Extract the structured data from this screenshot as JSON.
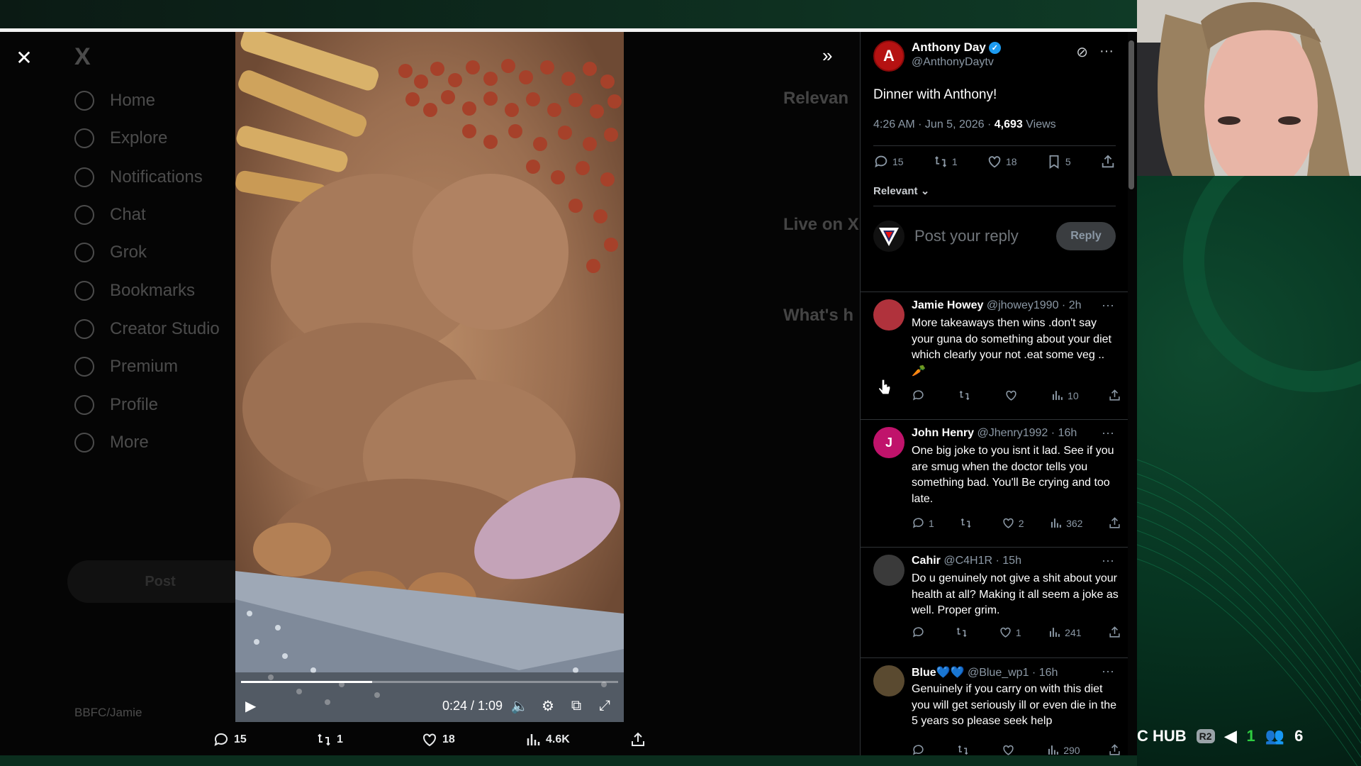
{
  "nav": {
    "logo": "X",
    "items": [
      "Home",
      "Explore",
      "Notifications",
      "Chat",
      "Grok",
      "Bookmarks",
      "Creator Studio",
      "Premium",
      "Profile",
      "More"
    ],
    "post_label": "Post",
    "account_name": "BBFC/Jamie"
  },
  "background_right": {
    "relevant_header": "Relevan",
    "live_header": "Live on X",
    "whats_header": "What's h"
  },
  "video": {
    "time": "0:24 / 1:09",
    "progress": 0.348
  },
  "stats": {
    "replies": "15",
    "reposts": "1",
    "likes": "18",
    "views": "4.6K"
  },
  "post": {
    "author_name": "Anthony Day",
    "author_handle": "@AnthonyDaytv",
    "avatar_letter": "A",
    "text": "Dinner with Anthony!",
    "timestamp": "4:26 AM · Jun 5, 2026 · ",
    "views_count": "4,693",
    "views_label": " Views",
    "actions": {
      "replies": "15",
      "reposts": "1",
      "likes": "18",
      "bookmarks": "5"
    },
    "sort_label": "Relevant"
  },
  "reply_box": {
    "placeholder": "Post your reply",
    "button": "Reply"
  },
  "replies": [
    {
      "name": "Jamie Howey",
      "meta": " @jhowey1990 · 2h",
      "text": "More takeaways then wins .don't say your guna do something about your diet which clearly your not .eat some veg .. 🥕",
      "replies": "",
      "reposts": "",
      "likes": "",
      "views": "10",
      "avatar_color": "#b0323c"
    },
    {
      "name": "John Henry",
      "meta": " @Jhenry1992 · 16h",
      "text": "One big joke to you isnt it lad. See if you are smug when the doctor tells you something bad.  You'll Be crying and too late.",
      "replies": "1",
      "reposts": "",
      "likes": "2",
      "views": "362",
      "avatar_letter": "J",
      "avatar_color": "#c0136b"
    },
    {
      "name": "Cahir",
      "meta": " @C4H1R · 15h",
      "text": "Do u genuinely not give a shit about your health at all? Making it all seem a joke as well. Proper grim.",
      "replies": "",
      "reposts": "",
      "likes": "1",
      "views": "241",
      "avatar_color": "#3a3a3a"
    },
    {
      "name": "Blue💙💙",
      "meta": " @Blue_wp1 · 16h",
      "text": "Genuinely if you carry on with this diet you will get seriously ill or even die in the 5 years so please seek help",
      "replies": "",
      "reposts": "",
      "likes": "",
      "views": "290",
      "avatar_color": "#5a4a30"
    }
  ],
  "overlay": {
    "hub_text": "C HUB",
    "r2_badge": "R2",
    "green_count": "1",
    "people_count": "6"
  },
  "colors": {
    "accent": "#1d9bf0",
    "background": "#000000",
    "muted": "#8b98a5"
  }
}
